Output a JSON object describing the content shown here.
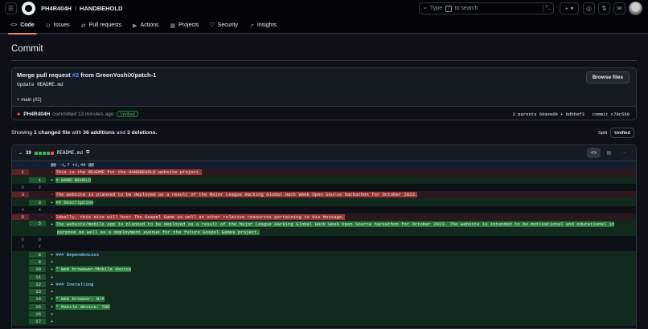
{
  "header": {
    "owner": "PH4R404H",
    "separator": "/",
    "repo": "HANDBEHOLD",
    "search_prefix": "Type",
    "search_key": "/",
    "search_suffix": "to search"
  },
  "tabs": [
    {
      "label": "Code",
      "icon": "code-icon"
    },
    {
      "label": "Issues",
      "icon": "issue-icon"
    },
    {
      "label": "Pull requests",
      "icon": "pull-request-icon"
    },
    {
      "label": "Actions",
      "icon": "play-icon"
    },
    {
      "label": "Projects",
      "icon": "table-icon"
    },
    {
      "label": "Security",
      "icon": "shield-icon"
    },
    {
      "label": "Insights",
      "icon": "graph-icon"
    }
  ],
  "page_title": "Commit",
  "commit": {
    "title_prefix": "Merge pull request",
    "pr_ref": "#2",
    "title_suffix": "from GreenYoshiX/patch-1",
    "description": "Update README.md",
    "browse_label": "Browse files",
    "branch": "main (#2)",
    "author": "PH4R404H",
    "action": "committed 13 minutes ago",
    "verified": "Verified",
    "parents_label": "2 parents",
    "parent1": "69aee0b",
    "plus": "+",
    "parent2": "bdbbef3",
    "commit_label": "commit",
    "commit_sha": "c78c569"
  },
  "summary": {
    "showing": "Showing",
    "changed": "1 changed file",
    "with": "with",
    "additions": "36 additions",
    "and": "and",
    "deletions": "3 deletions."
  },
  "view_toggle": {
    "split": "Split",
    "unified": "Unified"
  },
  "file": {
    "changes": "39",
    "name": "README.md"
  },
  "diff": {
    "hunk_left": "...",
    "hunk_right": "...",
    "hunk_header": "@@ -1,7 +1,40 @@",
    "lines": [
      {
        "type": "del",
        "old": "1",
        "new": "",
        "sign": "-",
        "text": "This is the README for the HANDBEHOLD website project."
      },
      {
        "type": "add",
        "old": "",
        "new": "1",
        "sign": "+",
        "text": "# HAND BEHOLD"
      },
      {
        "type": "ctx",
        "old": "2",
        "new": "2",
        "sign": "",
        "text": ""
      },
      {
        "type": "del",
        "old": "3",
        "new": "",
        "sign": "-",
        "text": "The website is planned to be deployed as a result of the Major League Hacking Global Hack Week Open Source hackathon for October 2023."
      },
      {
        "type": "add",
        "old": "",
        "new": "3",
        "sign": "+",
        "text": "## Description"
      },
      {
        "type": "ctx",
        "old": "4",
        "new": "4",
        "sign": "",
        "text": ""
      },
      {
        "type": "del",
        "old": "5",
        "new": "",
        "sign": "-",
        "text": "Ideally, this site will host The Gospel Game as well as other relative resources pertaining to His Message."
      },
      {
        "type": "add2",
        "old": "",
        "new": "5",
        "sign": "+",
        "text": "The website/mobile app is planned to be deployed as a result of the Major League Hacking Global Hack Week Open Source hackathon for October 2023. The website is intended to be motivational and educational in",
        "text2": "purpose as well as a deployment avenue for the future Gospel Games project."
      },
      {
        "type": "ctx",
        "old": "6",
        "new": "6",
        "sign": "",
        "text": ""
      },
      {
        "type": "ctx",
        "old": "7",
        "new": "7",
        "sign": "",
        "text": ""
      },
      {
        "type": "add",
        "old": "",
        "new": "8",
        "sign": "+",
        "text": "### Dependencies",
        "kw": true
      },
      {
        "type": "add",
        "old": "",
        "new": "9",
        "sign": "+",
        "text": ""
      },
      {
        "type": "add",
        "old": "",
        "new": "10",
        "sign": "+",
        "text": "* Web browswer/Mobile device"
      },
      {
        "type": "add",
        "old": "",
        "new": "11",
        "sign": "+",
        "text": ""
      },
      {
        "type": "add",
        "old": "",
        "new": "12",
        "sign": "+",
        "text": "### Installing",
        "kw": true
      },
      {
        "type": "add",
        "old": "",
        "new": "13",
        "sign": "+",
        "text": ""
      },
      {
        "type": "add",
        "old": "",
        "new": "14",
        "sign": "+",
        "text": "* Web browser: N/A"
      },
      {
        "type": "add",
        "old": "",
        "new": "15",
        "sign": "+",
        "text": "* Mobile device: TBD"
      },
      {
        "type": "add",
        "old": "",
        "new": "16",
        "sign": "+",
        "text": ""
      },
      {
        "type": "add",
        "old": "",
        "new": "17",
        "sign": "+",
        "text": ""
      }
    ]
  },
  "colors": {
    "accent": "#f78166",
    "link": "#4493f8",
    "add": "#3fb950",
    "del": "#f85149"
  }
}
